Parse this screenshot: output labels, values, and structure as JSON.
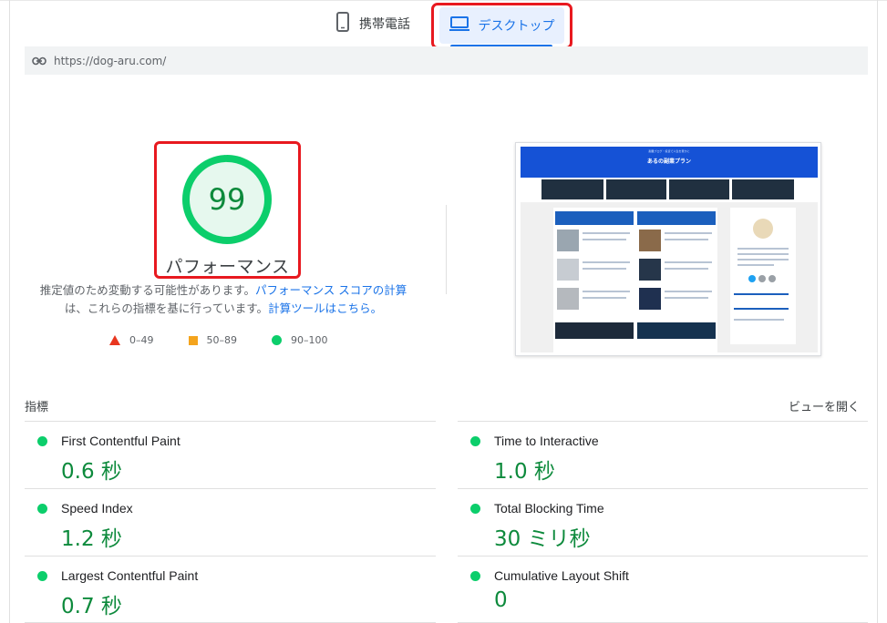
{
  "tabs": {
    "mobile_label": "携帯電話",
    "desktop_label": "デスクトップ"
  },
  "url": "https://dog-aru.com/",
  "performance": {
    "score": "99",
    "score_value": 99,
    "title": "パフォーマンス",
    "desc_line1": "推定値のため変動する可能性があります。",
    "desc_link1": "パフォーマンス スコアの計算",
    "desc_line2": "は、これらの指標を基に行っています。",
    "desc_link2": "計算ツールはこちら。"
  },
  "legend": {
    "fail": "0–49",
    "average": "50–89",
    "pass": "90–100"
  },
  "thumbnail": {
    "site_title": "あるの副業プラン",
    "site_subtitle": "副業ブログ・投資で人生を豊かに"
  },
  "metrics": {
    "heading": "指標",
    "toggle": "ビューを開く",
    "items": [
      {
        "name": "First Contentful Paint",
        "value": "0.6 秒"
      },
      {
        "name": "Time to Interactive",
        "value": "1.0 秒"
      },
      {
        "name": "Speed Index",
        "value": "1.2 秒"
      },
      {
        "name": "Total Blocking Time",
        "value": "30 ミリ秒"
      },
      {
        "name": "Largest Contentful Paint",
        "value": "0.7 秒"
      },
      {
        "name": "Cumulative Layout Shift",
        "value": "0"
      }
    ]
  },
  "colors": {
    "pass": "#0cce6b",
    "pass_text": "#0d8a3c",
    "average": "#f4a41d",
    "fail": "#e8361f",
    "accent": "#1a73e8",
    "highlight": "#e8191f"
  }
}
